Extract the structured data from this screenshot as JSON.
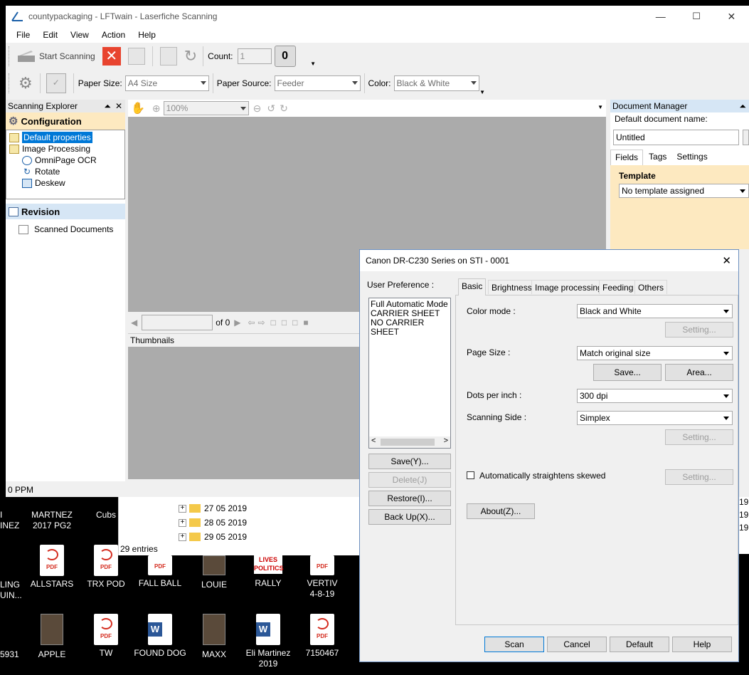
{
  "desktop": {
    "left_edge_labels": [
      "I",
      "INEZ",
      "LING",
      "UIN...",
      "5931"
    ],
    "icons": [
      {
        "label": "MARTNEZ\n2017 PG2",
        "type": "photo"
      },
      {
        "label": "Cubs",
        "type": "photo"
      },
      {
        "label": "ALLSTARS",
        "type": "pdf"
      },
      {
        "label": "TRX POD",
        "type": "pdf"
      },
      {
        "label": "FALL BALL",
        "type": "pdf"
      },
      {
        "label": "LOUIE",
        "type": "photo"
      },
      {
        "label": "RALLY",
        "type": "news"
      },
      {
        "label": "VERTIV\n4-8-19",
        "type": "pdf"
      },
      {
        "label": "APPLE",
        "type": "photo"
      },
      {
        "label": "TW",
        "type": "pdf"
      },
      {
        "label": "FOUND DOG",
        "type": "word"
      },
      {
        "label": "MAXX",
        "type": "photo"
      },
      {
        "label": "Eli Martinez\n2019",
        "type": "word"
      },
      {
        "label": "7150467",
        "type": "pdf"
      }
    ],
    "pdf_badge": "PDF",
    "news_badge": "LIVES\nPOLITICS",
    "word_badge": "W"
  },
  "explorer_window": {
    "folders": [
      "27 05 2019",
      "28 05 2019",
      "29 05 2019"
    ],
    "entries": "29 entries",
    "right_fragments": [
      "0",
      "19",
      "19",
      "19"
    ]
  },
  "lftwain": {
    "title": "countypackaging - LFTwain - Laserfiche Scanning",
    "menu": [
      "File",
      "Edit",
      "View",
      "Action",
      "Help"
    ],
    "toolbar1": {
      "start_scanning": "Start Scanning",
      "count_label": "Count:",
      "count_value": "1"
    },
    "toolbar2": {
      "paper_size_label": "Paper Size:",
      "paper_size_value": "A4 Size",
      "paper_source_label": "Paper Source:",
      "paper_source_value": "Feeder",
      "color_label": "Color:",
      "color_value": "Black & White"
    },
    "scanning_explorer": {
      "title": "Scanning Explorer",
      "configuration": "Configuration",
      "items": [
        "Default properties",
        "Image Processing",
        "OmniPage OCR",
        "Rotate",
        "Deskew"
      ],
      "revision": "Revision",
      "scanned_documents": "Scanned Documents"
    },
    "viewer": {
      "zoom": "100%",
      "of_label": "of 0",
      "thumbnails": "Thumbnails"
    },
    "status": "0 PPM",
    "document_manager": {
      "title": "Document Manager",
      "default_name_label": "Default document name:",
      "default_name_value": "Untitled",
      "tabs": [
        "Fields",
        "Tags",
        "Settings"
      ],
      "template_label": "Template",
      "template_value": "No template assigned"
    }
  },
  "dialog": {
    "title": "Canon DR-C230 Series on STI - 0001",
    "user_preference_label": "User Preference :",
    "preferences": [
      "Full Automatic Mode",
      "CARRIER SHEET",
      "NO CARRIER SHEET"
    ],
    "left_buttons": {
      "save": "Save(Y)...",
      "delete": "Delete(J)",
      "restore": "Restore(I)...",
      "backup": "Back Up(X)..."
    },
    "tabs": [
      "Basic",
      "Brightness",
      "Image processing",
      "Feeding",
      "Others"
    ],
    "color_mode_label": "Color mode :",
    "color_mode_value": "Black and White",
    "setting_label": "Setting...",
    "page_size_label": "Page Size :",
    "page_size_value": "Match original size",
    "save_btn": "Save...",
    "area_btn": "Area...",
    "dpi_label": "Dots per inch :",
    "dpi_value": "300 dpi",
    "side_label": "Scanning Side :",
    "side_value": "Simplex",
    "straighten_label": "Automatically straightens skewed",
    "about_btn": "About(Z)...",
    "bottom_buttons": {
      "scan": "Scan",
      "cancel": "Cancel",
      "default": "Default",
      "help": "Help"
    }
  },
  "colors": {
    "accent_blue": "#0078d7",
    "config_header": "#fde9c0",
    "revision_header": "#d6e6f5",
    "pdf_red": "#d42b1e"
  }
}
